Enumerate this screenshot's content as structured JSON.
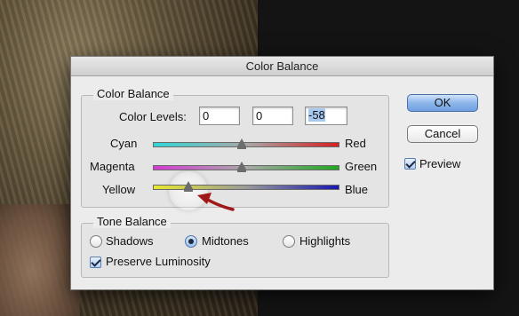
{
  "dialog": {
    "title": "Color Balance",
    "color_balance_group": "Color Balance",
    "color_levels_label": "Color Levels:",
    "levels": [
      "0",
      "0",
      "-58"
    ],
    "sliders": [
      {
        "left": "Cyan",
        "right": "Red",
        "value": 0
      },
      {
        "left": "Magenta",
        "right": "Green",
        "value": 0
      },
      {
        "left": "Yellow",
        "right": "Blue",
        "value": -58
      }
    ],
    "tone_balance_group": "Tone Balance",
    "tones": [
      {
        "label": "Shadows",
        "selected": false
      },
      {
        "label": "Midtones",
        "selected": true
      },
      {
        "label": "Highlights",
        "selected": false
      }
    ],
    "preserve_luminosity": {
      "label": "Preserve Luminosity",
      "checked": true
    },
    "ok_label": "OK",
    "cancel_label": "Cancel",
    "preview": {
      "label": "Preview",
      "checked": true
    }
  },
  "colors": {
    "ok_button": "#8db6ea",
    "annotation_arrow": "#a01818"
  }
}
